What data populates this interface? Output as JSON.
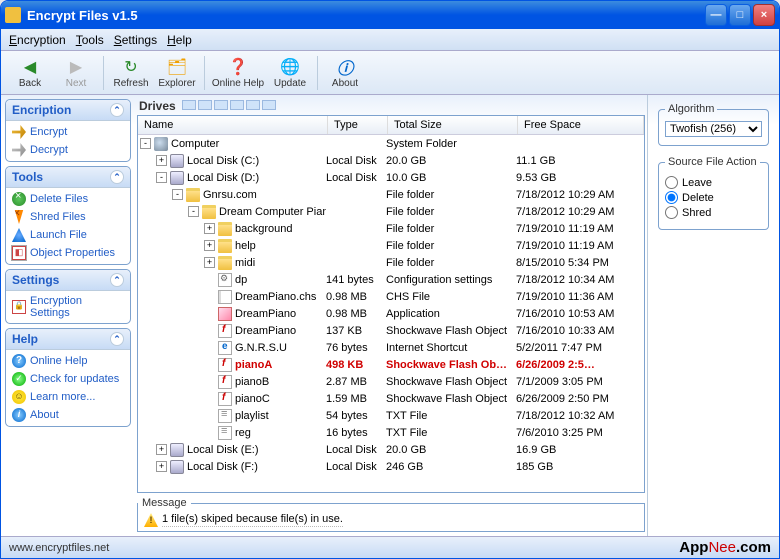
{
  "window": {
    "title": "Encrypt Files v1.5"
  },
  "menubar": {
    "items": [
      "Encryption",
      "Tools",
      "Settings",
      "Help"
    ]
  },
  "toolbar": {
    "back": "Back",
    "next": "Next",
    "refresh": "Refresh",
    "explorer": "Explorer",
    "onlinehelp": "Online Help",
    "update": "Update",
    "about": "About"
  },
  "sidebar": {
    "panels": [
      {
        "title": "Encription",
        "items": [
          {
            "label": "Encrypt",
            "icon": "key"
          },
          {
            "label": "Decrypt",
            "icon": "key-gray"
          }
        ]
      },
      {
        "title": "Tools",
        "items": [
          {
            "label": "Delete Files",
            "icon": "del"
          },
          {
            "label": "Shred Files",
            "icon": "shred"
          },
          {
            "label": "Launch File",
            "icon": "launch"
          },
          {
            "label": "Object Properties",
            "icon": "props"
          }
        ]
      },
      {
        "title": "Settings",
        "items": [
          {
            "label": "Encryption Settings",
            "icon": "enc"
          }
        ]
      },
      {
        "title": "Help",
        "items": [
          {
            "label": "Online Help",
            "icon": "help"
          },
          {
            "label": "Check for updates",
            "icon": "check"
          },
          {
            "label": "Learn more...",
            "icon": "smile"
          },
          {
            "label": "About",
            "icon": "about"
          }
        ]
      }
    ]
  },
  "center": {
    "drives_label": "Drives",
    "columns": {
      "name": "Name",
      "type": "Type",
      "total": "Total Size",
      "free": "Free Space"
    },
    "rows": [
      {
        "indent": 0,
        "expand": "-",
        "icon": "computer",
        "name": "Computer",
        "type": "",
        "total": "System Folder",
        "free": ""
      },
      {
        "indent": 1,
        "expand": "+",
        "icon": "disk",
        "name": "Local Disk (C:)",
        "type": "Local Disk",
        "total": "20.0 GB",
        "free": "11.1 GB"
      },
      {
        "indent": 1,
        "expand": "-",
        "icon": "disk",
        "name": "Local Disk (D:)",
        "type": "Local Disk",
        "total": "10.0 GB",
        "free": "9.53 GB"
      },
      {
        "indent": 2,
        "expand": "-",
        "icon": "folder",
        "name": "Gnrsu.com",
        "type": "",
        "total": "File folder",
        "free": "7/18/2012 10:29 AM"
      },
      {
        "indent": 3,
        "expand": "-",
        "icon": "folder",
        "name": "Dream Computer Piano",
        "type": "",
        "total": "File folder",
        "free": "7/18/2012 10:29 AM"
      },
      {
        "indent": 4,
        "expand": "+",
        "icon": "folder",
        "name": "background",
        "type": "",
        "total": "File folder",
        "free": "7/19/2010 11:19 AM"
      },
      {
        "indent": 4,
        "expand": "+",
        "icon": "folder",
        "name": "help",
        "type": "",
        "total": "File folder",
        "free": "7/19/2010 11:19 AM"
      },
      {
        "indent": 4,
        "expand": "+",
        "icon": "folder",
        "name": "midi",
        "type": "",
        "total": "File folder",
        "free": "8/15/2010 5:34 PM"
      },
      {
        "indent": 4,
        "expand": "",
        "icon": "cfg",
        "name": "dp",
        "type": "141 bytes",
        "total": "Configuration settings",
        "free": "7/18/2012 10:34 AM"
      },
      {
        "indent": 4,
        "expand": "",
        "icon": "file",
        "name": "DreamPiano.chs",
        "type": "0.98 MB",
        "total": "CHS File",
        "free": "7/19/2010 11:36 AM"
      },
      {
        "indent": 4,
        "expand": "",
        "icon": "app",
        "name": "DreamPiano",
        "type": "0.98 MB",
        "total": "Application",
        "free": "7/16/2010 10:53 AM"
      },
      {
        "indent": 4,
        "expand": "",
        "icon": "swf",
        "name": "DreamPiano",
        "type": "137 KB",
        "total": "Shockwave Flash Object",
        "free": "7/16/2010 10:33 AM"
      },
      {
        "indent": 4,
        "expand": "",
        "icon": "url",
        "name": "G.N.R.S.U",
        "type": "76 bytes",
        "total": "Internet Shortcut",
        "free": "5/2/2011 7:47 PM"
      },
      {
        "indent": 4,
        "expand": "",
        "icon": "swf",
        "name": "pianoA",
        "type": "498 KB",
        "total": "Shockwave Flash Ob…",
        "free": "6/26/2009 2:5…",
        "red": true
      },
      {
        "indent": 4,
        "expand": "",
        "icon": "swf",
        "name": "pianoB",
        "type": "2.87 MB",
        "total": "Shockwave Flash Object",
        "free": "7/1/2009 3:05 PM"
      },
      {
        "indent": 4,
        "expand": "",
        "icon": "swf",
        "name": "pianoC",
        "type": "1.59 MB",
        "total": "Shockwave Flash Object",
        "free": "6/26/2009 2:50 PM"
      },
      {
        "indent": 4,
        "expand": "",
        "icon": "txt",
        "name": "playlist",
        "type": "54 bytes",
        "total": "TXT File",
        "free": "7/18/2012 10:32 AM"
      },
      {
        "indent": 4,
        "expand": "",
        "icon": "txt",
        "name": "reg",
        "type": "16 bytes",
        "total": "TXT File",
        "free": "7/6/2010 3:25 PM"
      },
      {
        "indent": 1,
        "expand": "+",
        "icon": "disk",
        "name": "Local Disk (E:)",
        "type": "Local Disk",
        "total": "20.0 GB",
        "free": "16.9 GB"
      },
      {
        "indent": 1,
        "expand": "+",
        "icon": "disk",
        "name": "Local Disk (F:)",
        "type": "Local Disk",
        "total": "246 GB",
        "free": "185 GB"
      }
    ],
    "message_label": "Message",
    "message_text": "1 file(s) skiped because file(s) in use."
  },
  "right": {
    "algorithm_label": "Algorithm",
    "algorithm_value": "Twofish (256)",
    "sourceaction_label": "Source File Action",
    "actions": {
      "leave": "Leave",
      "delete": "Delete",
      "shred": "Shred"
    },
    "selected": "delete"
  },
  "status": {
    "url": "www.encryptfiles.net",
    "brand1": "App",
    "brand2": "Nee",
    "brand3": ".com"
  }
}
